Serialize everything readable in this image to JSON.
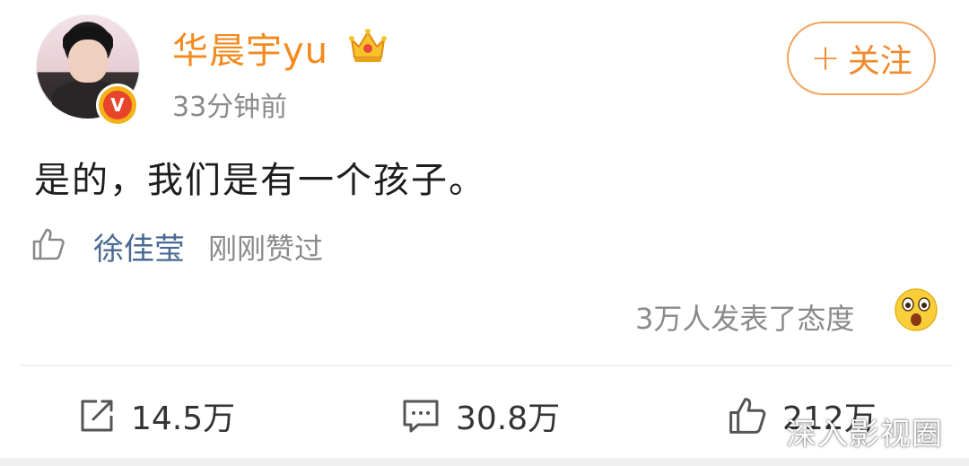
{
  "post": {
    "username": "华晨宇yu",
    "time": "33分钟前",
    "text": "是的，我们是有一个孩子。",
    "verified_badge": "V"
  },
  "follow": {
    "plus": "+",
    "label": "关注"
  },
  "likes": {
    "user": "徐佳莹",
    "text": "刚刚赞过"
  },
  "reactions": {
    "text": "3万人发表了态度"
  },
  "actions": {
    "repost_count": "14.5万",
    "comment_count": "30.8万",
    "like_count": "212万"
  },
  "watermark": "深入影视圈",
  "colors": {
    "username": "#f28a1e",
    "follow_border": "#f3a25a",
    "liked_user": "#4a6a92",
    "muted": "#8a8a8a"
  },
  "icons": {
    "crown": "crown-icon",
    "thumb": "thumbs-up-icon",
    "repost": "repost-icon",
    "comment": "comment-icon",
    "surprise": "surprised-emoji-icon"
  }
}
